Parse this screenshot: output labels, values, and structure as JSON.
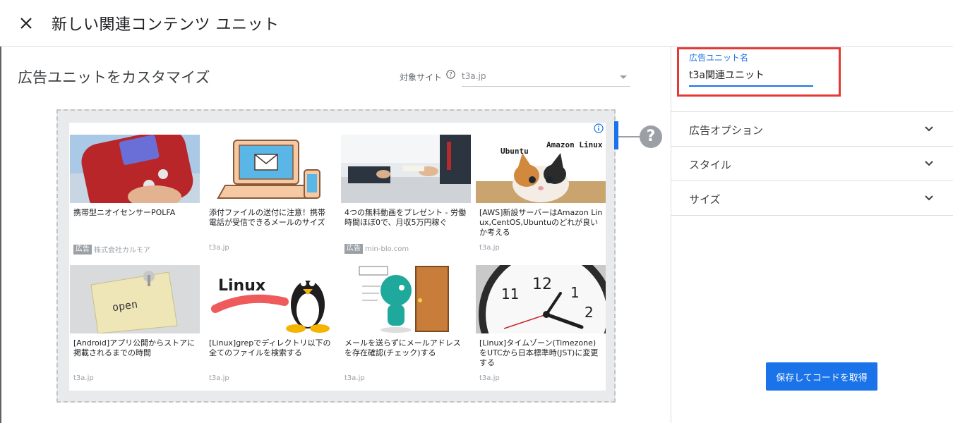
{
  "header": {
    "title": "新しい関連コンテンツ ユニット"
  },
  "main": {
    "heading": "広告ユニットをカスタマイズ",
    "site_selector": {
      "label": "対象サイト",
      "value": "t3a.jp"
    }
  },
  "preview": {
    "ad_badge": "広告",
    "cards": [
      {
        "title": "携帯型ニオイセンサーPOLFA",
        "source": "株式会社カルモア",
        "is_ad": true,
        "thumb": "odor-sensor-device"
      },
      {
        "title": "添付ファイルの送付に注意！携帯電話が受信できるメールのサイズ",
        "source": "t3a.jp",
        "is_ad": false,
        "thumb": "laptop-mail-illustration"
      },
      {
        "title": "4つの無料動画をプレゼント - 労働時間ほぼ0で、月収5万円稼ぐ",
        "source": "min-blo.com",
        "is_ad": true,
        "thumb": "business-meeting-photo"
      },
      {
        "title": "[AWS]新設サーバーはAmazon Linux,CentOS,Ubuntuのどれが良いか考える",
        "source": "t3a.jp",
        "is_ad": false,
        "thumb": "kitten-photo",
        "thumb_texts": [
          "Ubuntu",
          "Amazon Linux"
        ]
      },
      {
        "title": "[Android]アプリ公開からストアに掲載されるまでの時間",
        "source": "t3a.jp",
        "is_ad": false,
        "thumb": "open-note-photo",
        "thumb_text": "open"
      },
      {
        "title": "[Linux]grepでディレクトリ以下の全てのファイルを検索する",
        "source": "t3a.jp",
        "is_ad": false,
        "thumb": "linux-penguin",
        "thumb_text": "Linux"
      },
      {
        "title": "メールを送らずにメールアドレスを存在確認(チェック)する",
        "source": "t3a.jp",
        "is_ad": false,
        "thumb": "door-character-illustration"
      },
      {
        "title": "[Linux]タイムゾーン(Timezone)をUTCから日本標準時(JST)に変更する",
        "source": "t3a.jp",
        "is_ad": false,
        "thumb": "wall-clock-photo"
      }
    ]
  },
  "right_panel": {
    "name_field": {
      "label": "広告ユニット名",
      "value": "t3a関連ユニット"
    },
    "sections": [
      {
        "label": "広告オプション"
      },
      {
        "label": "スタイル"
      },
      {
        "label": "サイズ"
      }
    ],
    "save_button": "保存してコードを取得"
  },
  "colors": {
    "accent": "#1a73e8",
    "highlight": "#e53935"
  }
}
